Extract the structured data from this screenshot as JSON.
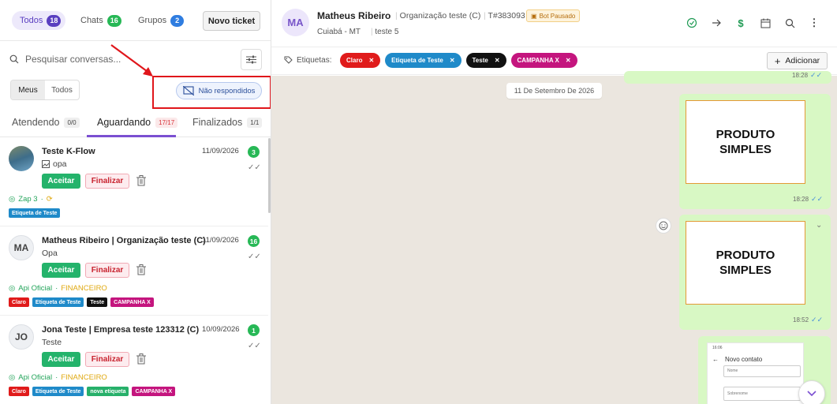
{
  "filters": {
    "all": {
      "label": "Todos",
      "count": "18"
    },
    "chats": {
      "label": "Chats",
      "count": "16"
    },
    "groups": {
      "label": "Grupos",
      "count": "2"
    },
    "new_ticket": "Novo ticket"
  },
  "search": {
    "placeholder": "Pesquisar conversas..."
  },
  "scope": {
    "mine": "Meus",
    "all": "Todos"
  },
  "unanswered": "Não respondidos",
  "tabs": [
    {
      "label": "Atendendo",
      "count": "0/0"
    },
    {
      "label": "Aguardando",
      "count": "17/17"
    },
    {
      "label": "Finalizados",
      "count": "1/1"
    }
  ],
  "tickets": [
    {
      "name": "Teste K-Flow",
      "date": "11/09/2026",
      "preview": "opa",
      "unread": "3",
      "accept": "Aceitar",
      "finish": "Finalizar",
      "channel": "Zap 3",
      "department": "",
      "tags": [
        {
          "label": "Etiqueta de Teste",
          "color": "#1f8ac9"
        }
      ]
    },
    {
      "name": "Matheus Ribeiro | Organização teste (C)",
      "initials": "MA",
      "date": "11/09/2026",
      "preview": "Opa",
      "unread": "16",
      "accept": "Aceitar",
      "finish": "Finalizar",
      "channel": "Api Oficial",
      "department": "FINANCEIRO",
      "tags": [
        {
          "label": "Claro",
          "color": "#e01b1b"
        },
        {
          "label": "Etiqueta de Teste",
          "color": "#1f8ac9"
        },
        {
          "label": "Teste",
          "color": "#111111"
        },
        {
          "label": "CAMPANHA X",
          "color": "#c4157e"
        }
      ]
    },
    {
      "name": "Jona Teste | Empresa teste 123312 (C)",
      "initials": "JO",
      "date": "10/09/2026",
      "preview": "Teste",
      "unread": "1",
      "accept": "Aceitar",
      "finish": "Finalizar",
      "channel": "Api Oficial",
      "department": "FINANCEIRO",
      "tags": [
        {
          "label": "Claro",
          "color": "#e01b1b"
        },
        {
          "label": "Etiqueta de Teste",
          "color": "#1f8ac9"
        },
        {
          "label": "nova etiqueta",
          "color": "#27b06a"
        },
        {
          "label": "CAMPANHA X",
          "color": "#c4157e"
        }
      ]
    }
  ],
  "header": {
    "initials": "MA",
    "name": "Matheus Ribeiro",
    "org": "Organização teste (C)",
    "ticket": "T#383093",
    "bot": "Bot Pausado",
    "city": "Cuiabá - MT",
    "queue": "teste 5"
  },
  "labels": {
    "title": "Etiquetas:",
    "chips": [
      {
        "label": "Claro",
        "color": "#e01b1b"
      },
      {
        "label": "Etiqueta de Teste",
        "color": "#1f8ac9"
      },
      {
        "label": "Teste",
        "color": "#111111"
      },
      {
        "label": "CAMPANHA X",
        "color": "#c4157e"
      }
    ],
    "add": "Adicionar"
  },
  "chat": {
    "date": "11 De Setembro De 2026",
    "messages": [
      {
        "time": "18:28"
      },
      {
        "text_l1": "PRODUTO",
        "text_l2": "SIMPLES",
        "time": "18:28"
      },
      {
        "text_l1": "PRODUTO",
        "text_l2": "SIMPLES",
        "time": "18:52"
      }
    ],
    "phone": {
      "clock": "16:06",
      "title": "Novo contato",
      "f1": "Nome",
      "f2": "Sobrenome"
    }
  },
  "colors": {
    "accent": "#7b4fd1",
    "green": "#24b36b",
    "alert": "#e0161b"
  }
}
